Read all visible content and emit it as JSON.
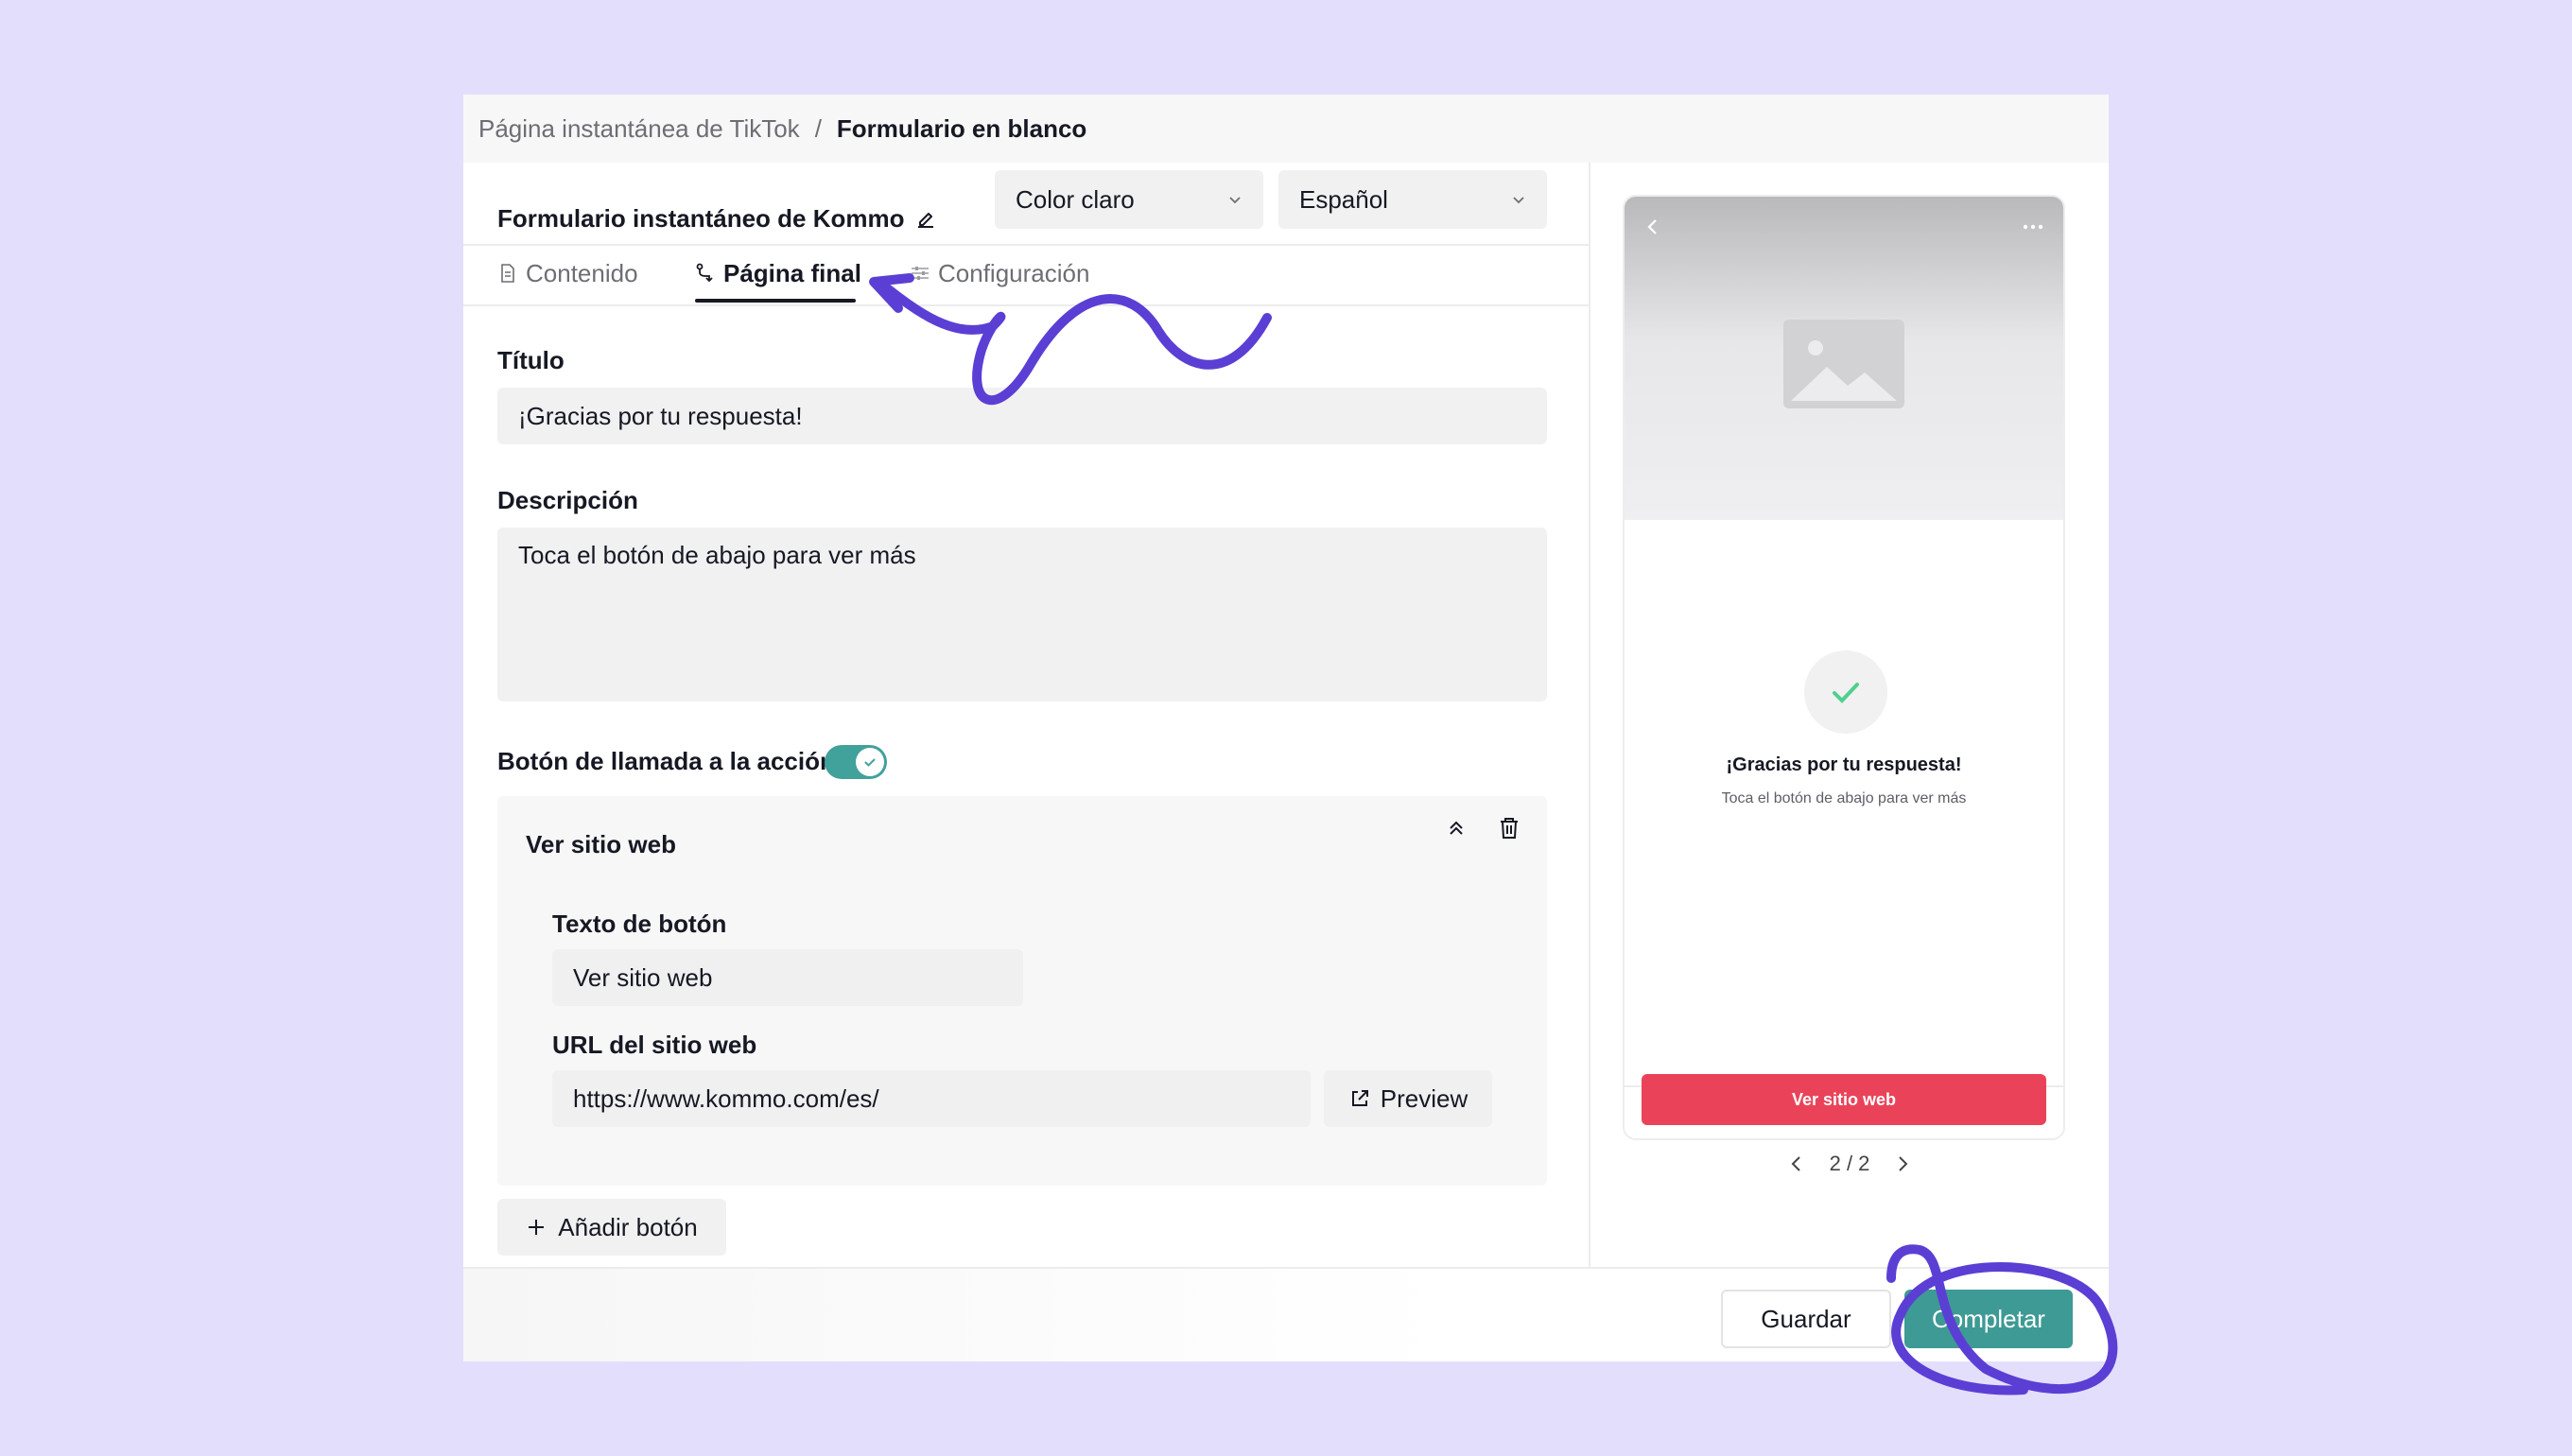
{
  "breadcrumb": {
    "parent": "Página instantánea de TikTok",
    "separator": "/",
    "current": "Formulario en blanco"
  },
  "form": {
    "name": "Formulario instantáneo de Kommo"
  },
  "selects": {
    "theme": "Color claro",
    "language": "Español"
  },
  "tabs": [
    {
      "label": "Contenido",
      "icon": "document-icon"
    },
    {
      "label": "Página final",
      "icon": "route-icon",
      "active": true
    },
    {
      "label": "Configuración",
      "icon": "sliders-icon"
    }
  ],
  "fields": {
    "title_label": "Título",
    "title_value": "¡Gracias por tu respuesta!",
    "description_label": "Descripción",
    "description_value": "Toca el botón de abajo para ver más"
  },
  "cta": {
    "label": "Botón de llamada a la acción",
    "enabled": true,
    "card_title": "Ver sitio web",
    "button_text_label": "Texto de botón",
    "button_text_value": "Ver sitio web",
    "url_label": "URL del sitio web",
    "url_value": "https://www.kommo.com/es/",
    "preview_label": "Preview",
    "add_button_label": "Añadir botón"
  },
  "footer": {
    "save": "Guardar",
    "complete": "Completar"
  },
  "phone": {
    "title": "¡Gracias por tu respuesta!",
    "description": "Toca el botón de abajo para ver más",
    "button": "Ver sitio web",
    "page_indicator": "2 / 2"
  },
  "colors": {
    "accent": "#3e9a94",
    "cta_red": "#ea4359",
    "annotation": "#5b3fd4",
    "background": "#e4defd"
  }
}
